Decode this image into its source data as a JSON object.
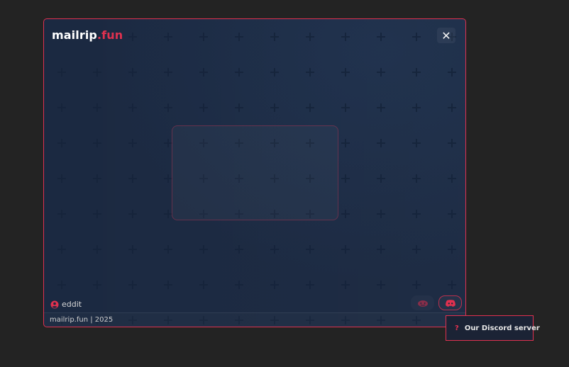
{
  "app": {
    "logo_main": "mailrip",
    "logo_accent": ".fun"
  },
  "window": {
    "close_glyph": "✕"
  },
  "user": {
    "name": "eddit",
    "icon": "user-circle-icon"
  },
  "socials": {
    "reddit_icon": "reddit-icon",
    "discord_icon": "discord-icon"
  },
  "footer": {
    "text": "mailrip.fun | 2025"
  },
  "tooltip": {
    "glyph": "?",
    "label": "Our Discord server"
  },
  "colors": {
    "accent": "#e0314f",
    "panel": "#1b2941",
    "page_bg": "#232323"
  }
}
